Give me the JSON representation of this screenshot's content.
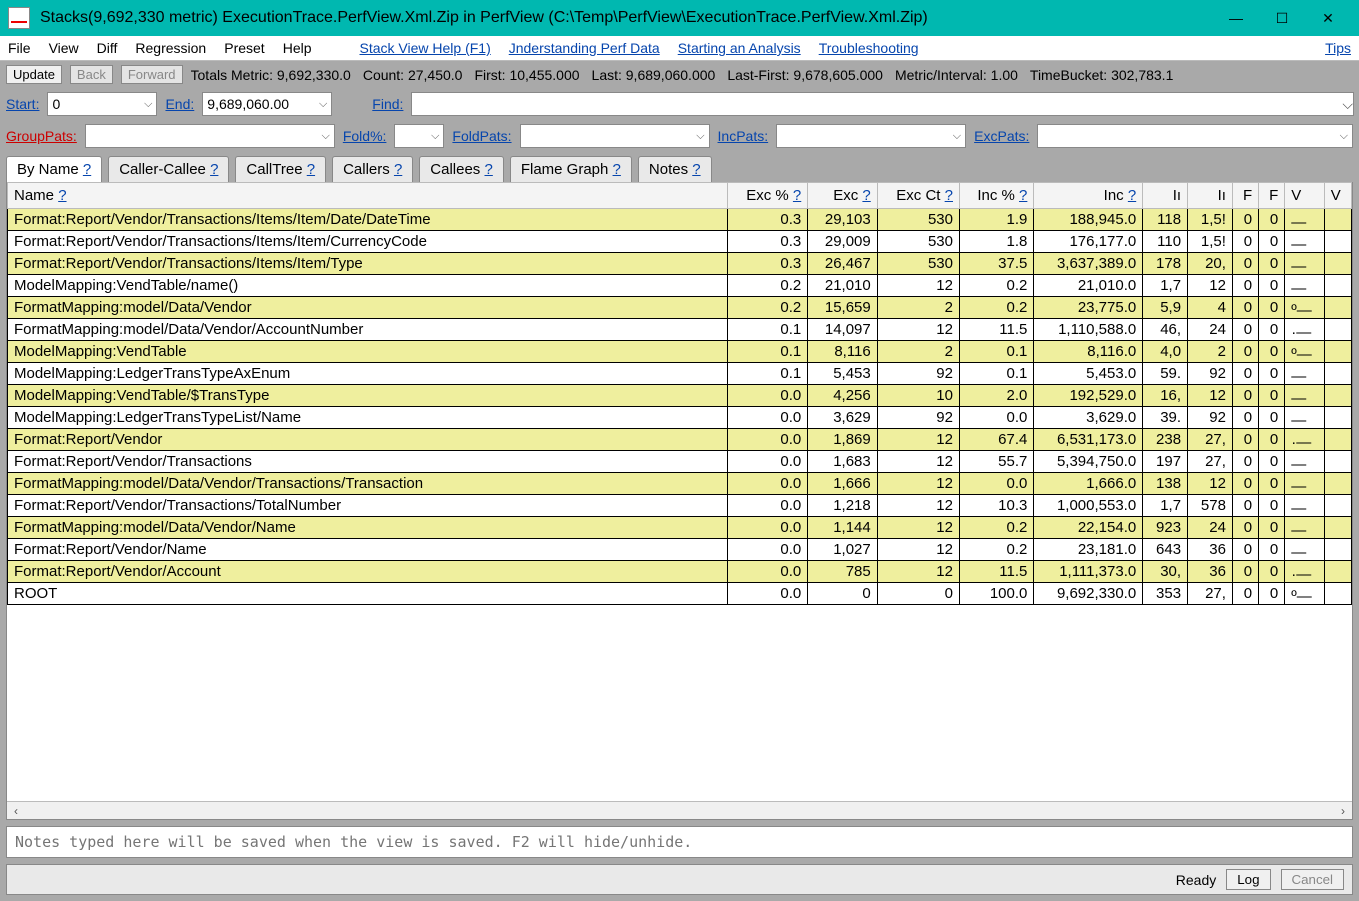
{
  "window": {
    "title": "Stacks(9,692,330 metric) ExecutionTrace.PerfView.Xml.Zip in PerfView (C:\\Temp\\PerfView\\ExecutionTrace.PerfView.Xml.Zip)",
    "min_glyph": "—",
    "max_glyph": "☐",
    "close_glyph": "✕"
  },
  "menu": {
    "items": [
      "File",
      "View",
      "Diff",
      "Regression",
      "Preset",
      "Help"
    ],
    "links": [
      {
        "label": "Stack View Help (F1)"
      },
      {
        "label": "Jnderstanding Perf Data"
      },
      {
        "label": "Starting an Analysis"
      },
      {
        "label": "Troubleshooting"
      },
      {
        "label": "Tips"
      }
    ]
  },
  "toolbar": {
    "update": "Update",
    "back": "Back",
    "forward": "Forward",
    "totals": "Totals Metric: 9,692,330.0",
    "count": "Count: 27,450.0",
    "first": "First: 10,455.000",
    "last": "Last: 9,689,060.000",
    "lastfirst": "Last-First: 9,678,605.000",
    "mi": "Metric/Interval: 1.00",
    "tb": "TimeBucket: 302,783.1"
  },
  "filters": {
    "start_label": "Start:",
    "start_value": "0",
    "end_label": "End:",
    "end_value": "9,689,060.00",
    "find_label": "Find:",
    "find_value": "",
    "grouppats_label": "GroupPats:",
    "grouppats_value": "",
    "foldpct_label": "Fold%:",
    "foldpct_value": "",
    "foldpats_label": "FoldPats:",
    "foldpats_value": "",
    "incpats_label": "IncPats:",
    "incpats_value": "",
    "excpats_label": "ExcPats:",
    "excpats_value": ""
  },
  "tabs": [
    {
      "label": "By Name",
      "q": "?",
      "active": true
    },
    {
      "label": "Caller-Callee",
      "q": "?"
    },
    {
      "label": "CallTree",
      "q": "?"
    },
    {
      "label": "Callers",
      "q": "?"
    },
    {
      "label": "Callees",
      "q": "?"
    },
    {
      "label": "Flame Graph",
      "q": "?"
    },
    {
      "label": "Notes",
      "q": "?"
    }
  ],
  "columns": [
    {
      "label": "Name",
      "q": "?",
      "align": "left",
      "w": "720"
    },
    {
      "label": "Exc %",
      "q": "?",
      "align": "right"
    },
    {
      "label": "Exc",
      "q": "?",
      "align": "right"
    },
    {
      "label": "Exc Ct",
      "q": "?",
      "align": "right"
    },
    {
      "label": "Inc %",
      "q": "?",
      "align": "right"
    },
    {
      "label": "Inc",
      "q": "?",
      "align": "right"
    },
    {
      "label": "Iı",
      "q": "",
      "align": "right"
    },
    {
      "label": "Iı",
      "q": "",
      "align": "right"
    },
    {
      "label": "F",
      "q": "",
      "align": "right"
    },
    {
      "label": "F",
      "q": "",
      "align": "right"
    },
    {
      "label": "V",
      "q": "",
      "align": "left"
    },
    {
      "label": "V",
      "q": "",
      "align": "left"
    }
  ],
  "rows": [
    {
      "alt": true,
      "name": "Format:Report/Vendor/Transactions/Items/Item/Date/DateTime",
      "excp": "0.3",
      "exc": "29,103",
      "excct": "530",
      "incp": "1.9",
      "inc": "188,945.0",
      "c1": "118",
      "c2": "1,5!",
      "f1": "0",
      "f2": "0",
      "spark": "—"
    },
    {
      "alt": false,
      "name": "Format:Report/Vendor/Transactions/Items/Item/CurrencyCode",
      "excp": "0.3",
      "exc": "29,009",
      "excct": "530",
      "incp": "1.8",
      "inc": "176,177.0",
      "c1": "110",
      "c2": "1,5!",
      "f1": "0",
      "f2": "0",
      "spark": "—"
    },
    {
      "alt": true,
      "name": "Format:Report/Vendor/Transactions/Items/Item/Type",
      "excp": "0.3",
      "exc": "26,467",
      "excct": "530",
      "incp": "37.5",
      "inc": "3,637,389.0",
      "c1": "178",
      "c2": "20,",
      "f1": "0",
      "f2": "0",
      "spark": "—"
    },
    {
      "alt": false,
      "name": "ModelMapping:VendTable/name()",
      "excp": "0.2",
      "exc": "21,010",
      "excct": "12",
      "incp": "0.2",
      "inc": "21,010.0",
      "c1": "1,7",
      "c2": "12",
      "f1": "0",
      "f2": "0",
      "spark": "—"
    },
    {
      "alt": true,
      "name": "FormatMapping:model/Data/Vendor",
      "excp": "0.2",
      "exc": "15,659",
      "excct": "2",
      "incp": "0.2",
      "inc": "23,775.0",
      "c1": "5,9",
      "c2": "4",
      "f1": "0",
      "f2": "0",
      "spark": "º—"
    },
    {
      "alt": false,
      "name": "FormatMapping:model/Data/Vendor/AccountNumber",
      "excp": "0.1",
      "exc": "14,097",
      "excct": "12",
      "incp": "11.5",
      "inc": "1,110,588.0",
      "c1": "46,",
      "c2": "24",
      "f1": "0",
      "f2": "0",
      "spark": "·—"
    },
    {
      "alt": true,
      "name": "ModelMapping:VendTable",
      "excp": "0.1",
      "exc": "8,116",
      "excct": "2",
      "incp": "0.1",
      "inc": "8,116.0",
      "c1": "4,0",
      "c2": "2",
      "f1": "0",
      "f2": "0",
      "spark": "º—"
    },
    {
      "alt": false,
      "name": "ModelMapping:LedgerTransTypeAxEnum",
      "excp": "0.1",
      "exc": "5,453",
      "excct": "92",
      "incp": "0.1",
      "inc": "5,453.0",
      "c1": "59.",
      "c2": "92",
      "f1": "0",
      "f2": "0",
      "spark": "—"
    },
    {
      "alt": true,
      "name": "ModelMapping:VendTable/$TransType",
      "excp": "0.0",
      "exc": "4,256",
      "excct": "10",
      "incp": "2.0",
      "inc": "192,529.0",
      "c1": "16,",
      "c2": "12",
      "f1": "0",
      "f2": "0",
      "spark": "—"
    },
    {
      "alt": false,
      "name": "ModelMapping:LedgerTransTypeList/Name",
      "excp": "0.0",
      "exc": "3,629",
      "excct": "92",
      "incp": "0.0",
      "inc": "3,629.0",
      "c1": "39.",
      "c2": "92",
      "f1": "0",
      "f2": "0",
      "spark": "—"
    },
    {
      "alt": true,
      "name": "Format:Report/Vendor",
      "excp": "0.0",
      "exc": "1,869",
      "excct": "12",
      "incp": "67.4",
      "inc": "6,531,173.0",
      "c1": "238",
      "c2": "27,",
      "f1": "0",
      "f2": "0",
      "spark": "·—"
    },
    {
      "alt": false,
      "name": "Format:Report/Vendor/Transactions",
      "excp": "0.0",
      "exc": "1,683",
      "excct": "12",
      "incp": "55.7",
      "inc": "5,394,750.0",
      "c1": "197",
      "c2": "27,",
      "f1": "0",
      "f2": "0",
      "spark": "—"
    },
    {
      "alt": true,
      "name": "FormatMapping:model/Data/Vendor/Transactions/Transaction",
      "excp": "0.0",
      "exc": "1,666",
      "excct": "12",
      "incp": "0.0",
      "inc": "1,666.0",
      "c1": "138",
      "c2": "12",
      "f1": "0",
      "f2": "0",
      "spark": "—"
    },
    {
      "alt": false,
      "name": "Format:Report/Vendor/Transactions/TotalNumber",
      "excp": "0.0",
      "exc": "1,218",
      "excct": "12",
      "incp": "10.3",
      "inc": "1,000,553.0",
      "c1": "1,7",
      "c2": "578",
      "f1": "0",
      "f2": "0",
      "spark": "—"
    },
    {
      "alt": true,
      "name": "FormatMapping:model/Data/Vendor/Name",
      "excp": "0.0",
      "exc": "1,144",
      "excct": "12",
      "incp": "0.2",
      "inc": "22,154.0",
      "c1": "923",
      "c2": "24",
      "f1": "0",
      "f2": "0",
      "spark": "—"
    },
    {
      "alt": false,
      "name": "Format:Report/Vendor/Name",
      "excp": "0.0",
      "exc": "1,027",
      "excct": "12",
      "incp": "0.2",
      "inc": "23,181.0",
      "c1": "643",
      "c2": "36",
      "f1": "0",
      "f2": "0",
      "spark": "—"
    },
    {
      "alt": true,
      "name": "Format:Report/Vendor/Account",
      "excp": "0.0",
      "exc": "785",
      "excct": "12",
      "incp": "11.5",
      "inc": "1,111,373.0",
      "c1": "30,",
      "c2": "36",
      "f1": "0",
      "f2": "0",
      "spark": "·—"
    },
    {
      "alt": false,
      "name": "ROOT",
      "excp": "0.0",
      "exc": "0",
      "excct": "0",
      "incp": "100.0",
      "inc": "9,692,330.0",
      "c1": "353",
      "c2": "27,",
      "f1": "0",
      "f2": "0",
      "spark": "º—"
    }
  ],
  "notes_placeholder": "Notes typed here will be saved when the view is saved. F2 will hide/unhide.",
  "status": {
    "ready": "Ready",
    "log": "Log",
    "cancel": "Cancel"
  }
}
